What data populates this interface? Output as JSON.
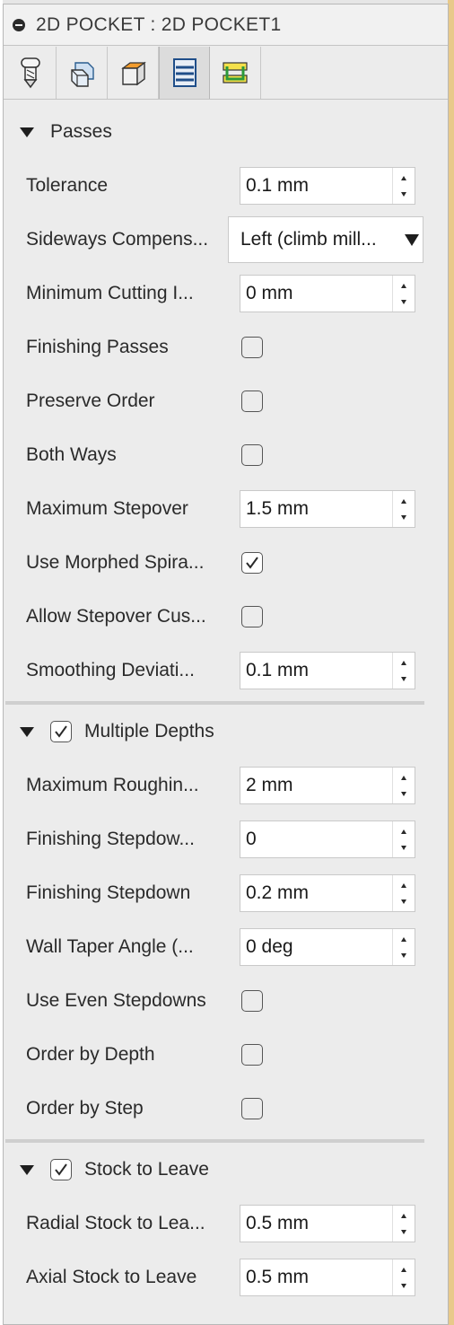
{
  "window": {
    "title": "2D POCKET : 2D POCKET1"
  },
  "tabs": [
    {
      "icon": "tool-icon",
      "active": false
    },
    {
      "icon": "geometry-icon",
      "active": false
    },
    {
      "icon": "heights-icon",
      "active": false
    },
    {
      "icon": "passes-icon",
      "active": true
    },
    {
      "icon": "linking-icon",
      "active": false
    }
  ],
  "passes": {
    "header": "Passes",
    "tolerance": {
      "label": "Tolerance",
      "value": "0.1 mm"
    },
    "sideways_compensation": {
      "label": "Sideways Compens...",
      "value": "Left (climb mill..."
    },
    "minimum_cutting": {
      "label": "Minimum Cutting I...",
      "value": "0 mm"
    },
    "finishing_passes": {
      "label": "Finishing Passes",
      "checked": false
    },
    "preserve_order": {
      "label": "Preserve Order",
      "checked": false
    },
    "both_ways": {
      "label": "Both Ways",
      "checked": false
    },
    "maximum_stepover": {
      "label": "Maximum Stepover",
      "value": "1.5 mm"
    },
    "use_morphed_spiral": {
      "label": "Use Morphed Spira...",
      "checked": true
    },
    "allow_stepover_cusps": {
      "label": "Allow Stepover Cus...",
      "checked": false
    },
    "smoothing_deviation": {
      "label": "Smoothing Deviati...",
      "value": "0.1 mm"
    }
  },
  "multiple_depths": {
    "header": "Multiple Depths",
    "checked": true,
    "maximum_roughing": {
      "label": "Maximum Roughin...",
      "value": "2 mm"
    },
    "finishing_stepdowns": {
      "label": "Finishing Stepdow...",
      "value": "0"
    },
    "finishing_stepdown": {
      "label": "Finishing Stepdown",
      "value": "0.2 mm"
    },
    "wall_taper_angle": {
      "label": "Wall Taper Angle (...",
      "value": "0 deg"
    },
    "use_even_stepdowns": {
      "label": "Use Even Stepdowns",
      "checked": false
    },
    "order_by_depth": {
      "label": "Order by Depth",
      "checked": false
    },
    "order_by_step": {
      "label": "Order by Step",
      "checked": false
    }
  },
  "stock_to_leave": {
    "header": "Stock to Leave",
    "checked": true,
    "radial": {
      "label": "Radial Stock to Lea...",
      "value": "0.5 mm"
    },
    "axial": {
      "label": "Axial Stock to Leave",
      "value": "0.5 mm"
    }
  }
}
